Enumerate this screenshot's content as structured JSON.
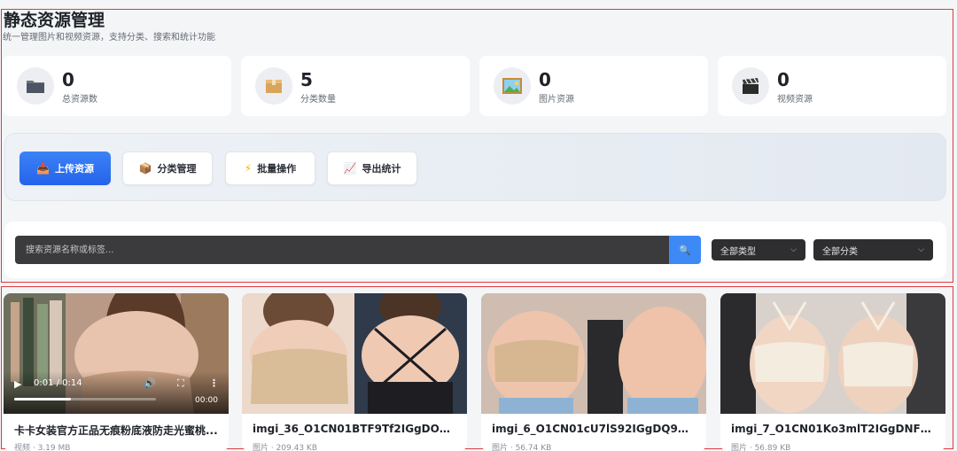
{
  "header": {
    "title": "静态资源管理",
    "subtitle": "统一管理图片和视频资源，支持分类、搜索和统计功能"
  },
  "stats": [
    {
      "icon": "folder-icon",
      "value": "0",
      "label": "总资源数"
    },
    {
      "icon": "box-icon",
      "value": "5",
      "label": "分类数量"
    },
    {
      "icon": "picture-icon",
      "value": "0",
      "label": "图片资源"
    },
    {
      "icon": "clapper-icon",
      "value": "0",
      "label": "视频资源"
    }
  ],
  "toolbar": {
    "upload_label": "上传资源",
    "category_label": "分类管理",
    "batch_label": "批量操作",
    "export_label": "导出统计"
  },
  "search": {
    "placeholder": "搜索资源名称或标签...",
    "type_select": "全部类型",
    "category_select": "全部分类"
  },
  "resources": [
    {
      "title": "卡卡女装官方正品无痕粉底液防走光蜜桃...",
      "meta": "视频 · 3.19 MB",
      "type": "video",
      "time": "0:01 / 0:14",
      "duration": "00:00",
      "progress": 0.4
    },
    {
      "title": "imgi_36_O1CN01BTF9Tf2IGgDOwpiBx...",
      "meta": "图片 · 209.43 KB",
      "type": "image"
    },
    {
      "title": "imgi_6_O1CN01cU7lS92IGgDQ9OnyR...",
      "meta": "图片 · 56.74 KB",
      "type": "image"
    },
    {
      "title": "imgi_7_O1CN01Ko3mlT2IGgDNFOot8...",
      "meta": "图片 · 56.89 KB",
      "type": "image"
    }
  ],
  "colors": {
    "accent": "#2f6ff0",
    "frame": "#e0393e"
  }
}
